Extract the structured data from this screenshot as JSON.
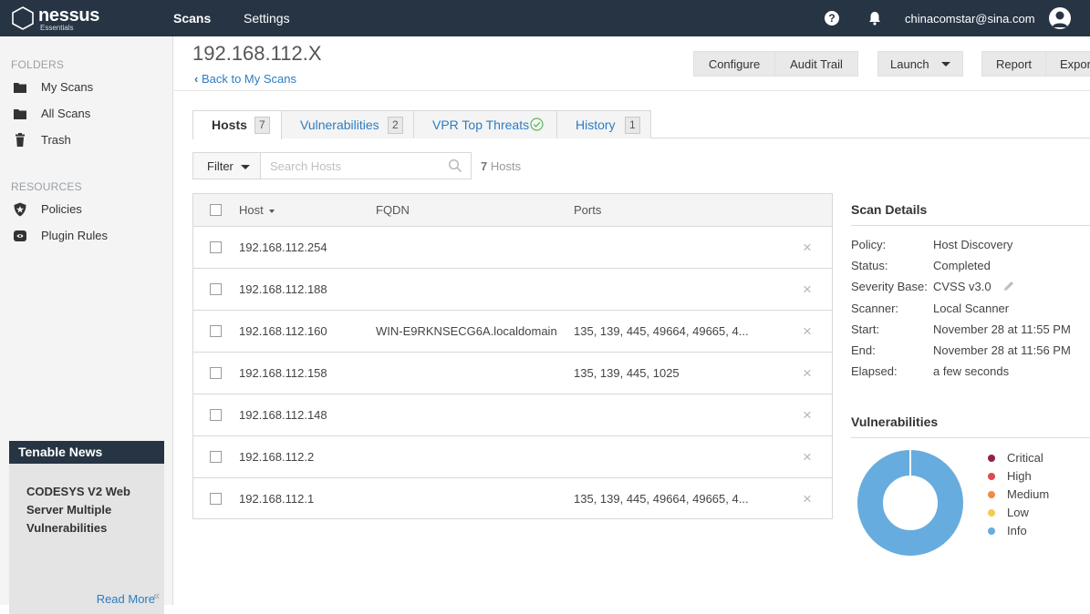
{
  "topbar": {
    "brand": "nessus",
    "edition": "Essentials",
    "nav": {
      "scans": "Scans",
      "settings": "Settings"
    },
    "help": "?",
    "user_email": "chinacomstar@sina.com"
  },
  "sidebar": {
    "folders_label": "FOLDERS",
    "folders": [
      {
        "label": "My Scans",
        "icon": "folder-icon"
      },
      {
        "label": "All Scans",
        "icon": "folder-icon"
      },
      {
        "label": "Trash",
        "icon": "trash-icon"
      }
    ],
    "resources_label": "RESOURCES",
    "resources": [
      {
        "label": "Policies",
        "icon": "shield-icon"
      },
      {
        "label": "Plugin Rules",
        "icon": "plugin-icon"
      }
    ],
    "news": {
      "title": "Tenable News",
      "headline": "CODESYS V2 Web Server Multiple Vulnerabilities",
      "read_more": "Read More"
    },
    "collapse": "«"
  },
  "header": {
    "title": "192.168.112.X",
    "back": "Back to My Scans",
    "buttons": {
      "configure": "Configure",
      "audit_trail": "Audit Trail",
      "launch": "Launch",
      "report": "Report",
      "export": "Export"
    }
  },
  "tabs": [
    {
      "label": "Hosts",
      "count": "7"
    },
    {
      "label": "Vulnerabilities",
      "count": "2"
    },
    {
      "label": "VPR Top Threats"
    },
    {
      "label": "History",
      "count": "1"
    }
  ],
  "filter": {
    "label": "Filter",
    "placeholder": "Search Hosts",
    "count": "7",
    "count_suffix": "Hosts"
  },
  "table": {
    "columns": {
      "host": "Host",
      "fqdn": "FQDN",
      "ports": "Ports"
    },
    "rows": [
      {
        "host": "192.168.112.254",
        "fqdn": "",
        "ports": ""
      },
      {
        "host": "192.168.112.188",
        "fqdn": "",
        "ports": ""
      },
      {
        "host": "192.168.112.160",
        "fqdn": "WIN-E9RKNSECG6A.localdomain",
        "ports": "135, 139, 445, 49664, 49665, 4..."
      },
      {
        "host": "192.168.112.158",
        "fqdn": "",
        "ports": "135, 139, 445, 1025"
      },
      {
        "host": "192.168.112.148",
        "fqdn": "",
        "ports": ""
      },
      {
        "host": "192.168.112.2",
        "fqdn": "",
        "ports": ""
      },
      {
        "host": "192.168.112.1",
        "fqdn": "",
        "ports": "135, 139, 445, 49664, 49665, 4..."
      }
    ],
    "remove_glyph": "×"
  },
  "scan_details": {
    "title": "Scan Details",
    "policy_label": "Policy:",
    "policy": "Host Discovery",
    "status_label": "Status:",
    "status": "Completed",
    "severity_label": "Severity Base:",
    "severity": "CVSS v3.0",
    "scanner_label": "Scanner:",
    "scanner": "Local Scanner",
    "start_label": "Start:",
    "start": "November 28 at 11:55 PM",
    "end_label": "End:",
    "end": "November 28 at 11:56 PM",
    "elapsed_label": "Elapsed:",
    "elapsed": "a few seconds"
  },
  "vulnerabilities": {
    "title": "Vulnerabilities",
    "legend": [
      {
        "label": "Critical",
        "color": "#91243e"
      },
      {
        "label": "High",
        "color": "#dd4b50"
      },
      {
        "label": "Medium",
        "color": "#f18c43"
      },
      {
        "label": "Low",
        "color": "#f8c851"
      },
      {
        "label": "Info",
        "color": "#67acdf"
      }
    ]
  },
  "chart_data": {
    "type": "pie",
    "categories": [
      "Critical",
      "High",
      "Medium",
      "Low",
      "Info"
    ],
    "values": [
      0,
      0,
      0,
      0,
      1
    ],
    "colors": [
      "#91243e",
      "#dd4b50",
      "#f18c43",
      "#f8c851",
      "#67acdf"
    ],
    "title": "Vulnerabilities",
    "legend": "right"
  }
}
